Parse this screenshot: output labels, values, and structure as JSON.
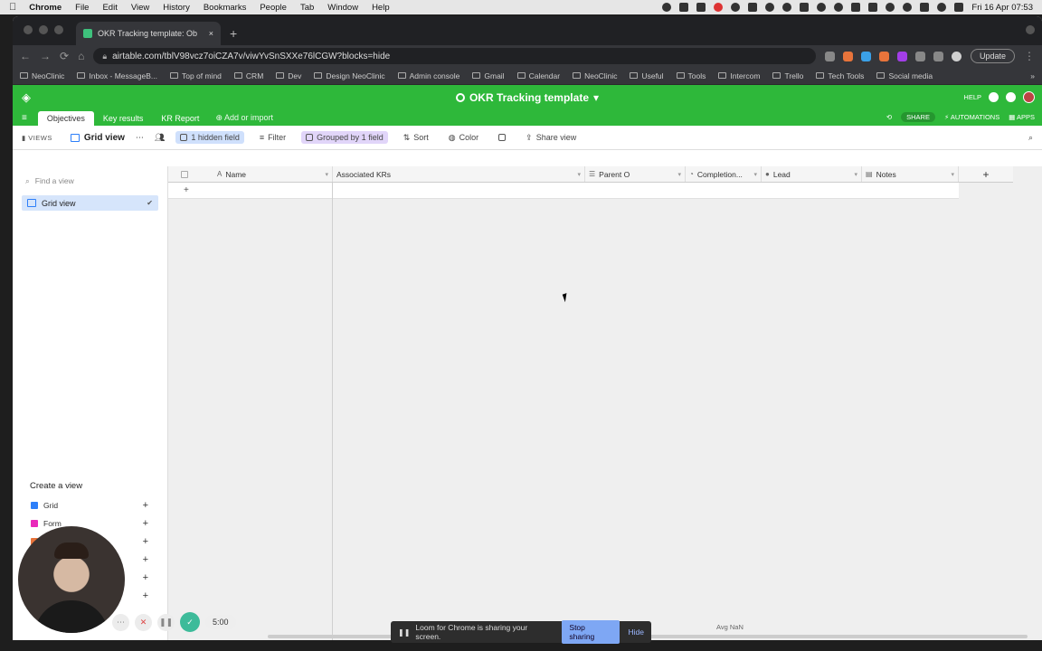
{
  "menubar": {
    "apple": "",
    "items": [
      "Chrome",
      "File",
      "Edit",
      "View",
      "History",
      "Bookmarks",
      "People",
      "Tab",
      "Window",
      "Help"
    ],
    "clock": "Fri 16 Apr  07:53"
  },
  "browser": {
    "tab_title": "OKR Tracking template: Ob",
    "tab_close": "×",
    "new_tab": "+",
    "url": "airtable.com/tblV98vcz7oiCZA7v/viwYvSnSXXe76lCGW?blocks=hide",
    "update_label": "Update",
    "bookmarks": [
      "NeoClinic",
      "Inbox - MessageB...",
      "Top of mind",
      "CRM",
      "Dev",
      "Design NeoClinic",
      "Admin console",
      "Gmail",
      "Calendar",
      "NeoClinic",
      "Useful",
      "Tools",
      "Intercom",
      "Trello",
      "Tech Tools",
      "Social media"
    ],
    "bookmarks_more": "»"
  },
  "airtable": {
    "base_title": "OKR Tracking template",
    "base_caret": "▾",
    "help": "HELP",
    "tables": [
      "Objectives",
      "Key results",
      "KR Report"
    ],
    "add_import": "Add or import",
    "share": "SHARE",
    "automations": "AUTOMATIONS",
    "apps": "APPS",
    "views_label": "VIEWS",
    "view_name": "Grid view",
    "hidden_field": "1 hidden field",
    "filter": "Filter",
    "grouped": "Grouped by 1 field",
    "sort": "Sort",
    "color": "Color",
    "share_view": "Share view"
  },
  "sidebar": {
    "find_placeholder": "Find a view",
    "views": [
      {
        "label": "Grid view",
        "check": "✔"
      }
    ],
    "create_heading": "Create a view",
    "create_items": [
      {
        "label": "Grid",
        "color": "#2d7ff9"
      },
      {
        "label": "Form",
        "color": "#e929ba"
      }
    ]
  },
  "grid": {
    "columns": [
      {
        "label": "Name",
        "icon": "A"
      },
      {
        "label": "Associated KRs",
        "icon": ""
      },
      {
        "label": "Parent O",
        "icon": "☰"
      },
      {
        "label": "Completion...",
        "icon": "◔"
      },
      {
        "label": "Lead",
        "icon": "●"
      },
      {
        "label": "Notes",
        "icon": "▤"
      }
    ],
    "add_column": "+",
    "add_row": "+",
    "summary": "Avg NaN"
  },
  "loom": {
    "message": "Loom for Chrome is sharing your screen.",
    "stop": "Stop sharing",
    "hide": "Hide",
    "timer": "5:00"
  },
  "colors": {
    "airtable_green": "#2eb83a",
    "active_view": "#d6e5fb"
  }
}
